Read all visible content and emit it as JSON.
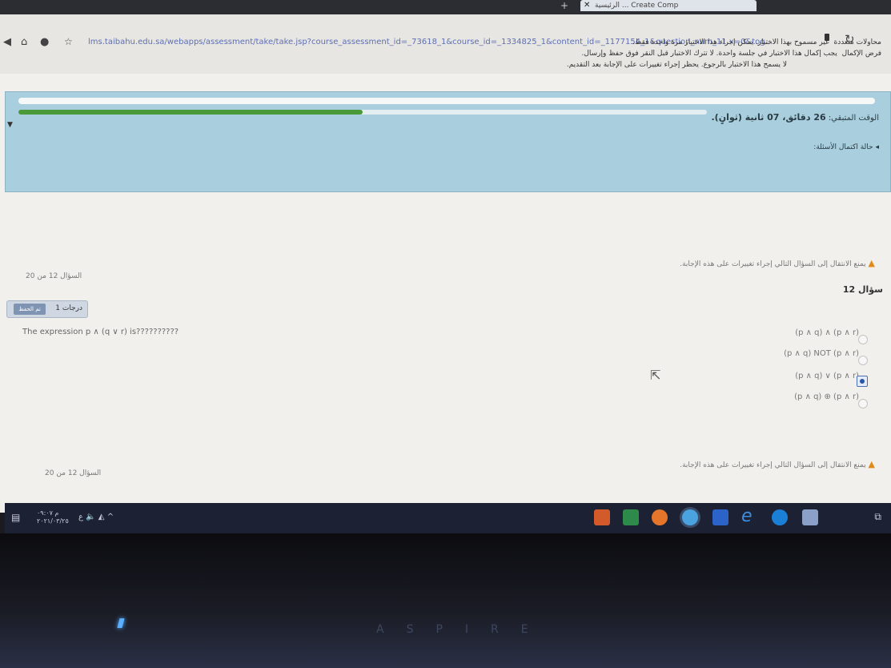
{
  "browser": {
    "tab_title": "الرئيسية ... Create Comp",
    "new_tab": "+",
    "url": "lms.taibahu.edu.sa/webapps/assessment/take/take.jsp?course_assessment_id=_73618_1&course_id=_1334825_1&content_id=_1177154_1&question_num_11.x=0&tog...",
    "refresh_icon": "refresh-icon"
  },
  "test_info": {
    "multiple_attempts_label": "محاولات متعددة",
    "multiple_attempts_value": "غير مسموح بهذا الاختبار. يمكن إجراء هذا الاختبار مرة واحدة فقط.",
    "force_completion_label": "فرض الإكمال",
    "force_completion_value": "يجب إكمال هذا الاختبار في جلسة واحدة. لا تترك الاختبار قبل النقر فوق حفظ وإرسال.",
    "backtracking": "لا يسمح هذا الاختبار بالرجوع. يحظر إجراء تغييرات على الإجابة بعد التقديم."
  },
  "timer": {
    "label": "الوقت المتبقي:",
    "value": "26 دقائق، 07 ثانية (ثوانٍ).",
    "progress": 0.5,
    "question_status": "حالة اكتمال الأسئلة:"
  },
  "question": {
    "warning_top": "يمنع الانتقال إلى السؤال التالي إجراء تغييرات على هذه الإجابة.",
    "counter_top": "السؤال 12 من 20",
    "title": "سؤال 12",
    "points": "1 درجات",
    "save_button": "تم الحفظ",
    "text": "The expression p ∧ (q ∨ r) is??????????",
    "options": [
      {
        "label": "(p ∧ q) ∧ (p ∧ r)",
        "selected": false
      },
      {
        "label": "(p ∧ q) NOT (p ∧ r)",
        "selected": false
      },
      {
        "label": "(p ∧ q) ∨ (p ∧ r)",
        "selected": true
      },
      {
        "label": "(p ∧ q) ⊕ (p ∧ r)",
        "selected": false
      }
    ],
    "warning_bottom": "يمنع الانتقال إلى السؤال التالي إجراء تغييرات على هذه الإجابة.",
    "counter_bottom": "السؤال 12 من 20"
  },
  "taskbar": {
    "time": "م ٠٩:٠٧",
    "date": "٢٠٢١/٠٣/٢٥",
    "language": "ع"
  },
  "laptop": {
    "brand": "ASPIRE"
  }
}
